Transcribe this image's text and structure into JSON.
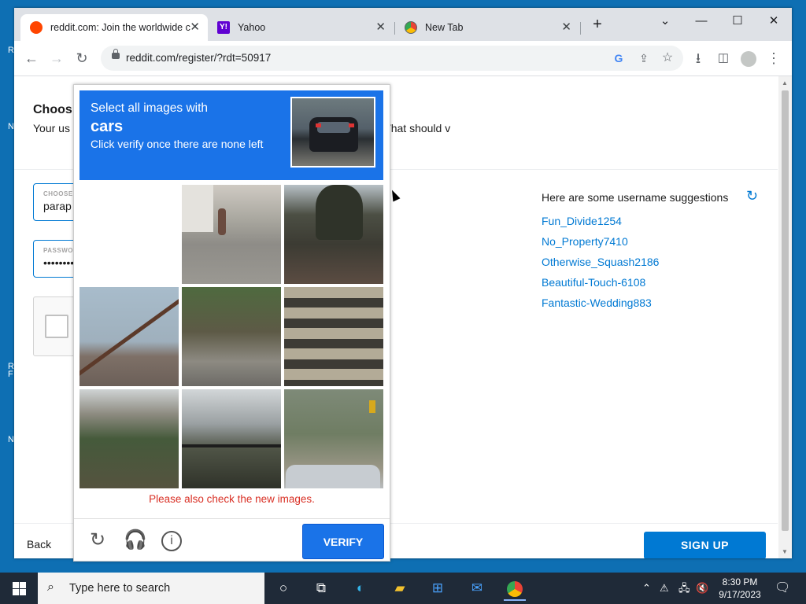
{
  "desktop": {
    "side_letters": [
      "R",
      "N",
      "R",
      "F",
      "N"
    ]
  },
  "browser": {
    "tabs": [
      {
        "title": "reddit.com: Join the worldwide c",
        "icon": "reddit-icon",
        "active": true
      },
      {
        "title": "Yahoo",
        "icon": "yahoo-icon",
        "active": false
      },
      {
        "title": "New Tab",
        "icon": "chrome-icon",
        "active": false
      }
    ],
    "url": "reddit.com/register/?rdt=50917"
  },
  "register": {
    "title": "Choos",
    "description": "Your us                                                                                  name will be used to credit you for things you share on Reddit. What should v",
    "username_label": "CHOOSE",
    "username_value": "parap",
    "password_label": "PASSWO",
    "password_value": "••••••••",
    "suggestions_heading": "Here are some username suggestions",
    "suggestions": [
      "Fun_Divide1254",
      "No_Property7410",
      "Otherwise_Squash2186",
      "Beautiful-Touch-6108",
      "Fantastic-Wedding883"
    ],
    "back_label": "Back",
    "signup_label": "SIGN UP"
  },
  "captcha": {
    "line1": "Select all images with",
    "target": "cars",
    "line3": "Click verify once there are none left",
    "warning": "Please also check the new images.",
    "verify_label": "VERIFY",
    "tiles": [
      "blank",
      "street-person",
      "trees-road",
      "roof",
      "plant-rocks",
      "crosswalk",
      "bridge",
      "fence-house",
      "car-signal"
    ]
  },
  "taskbar": {
    "search_placeholder": "Type here to search",
    "time": "8:30 PM",
    "date": "9/17/2023"
  },
  "colors": {
    "reddit_blue": "#0079d3",
    "captcha_blue": "#1a73e8",
    "warning_red": "#d93025"
  }
}
